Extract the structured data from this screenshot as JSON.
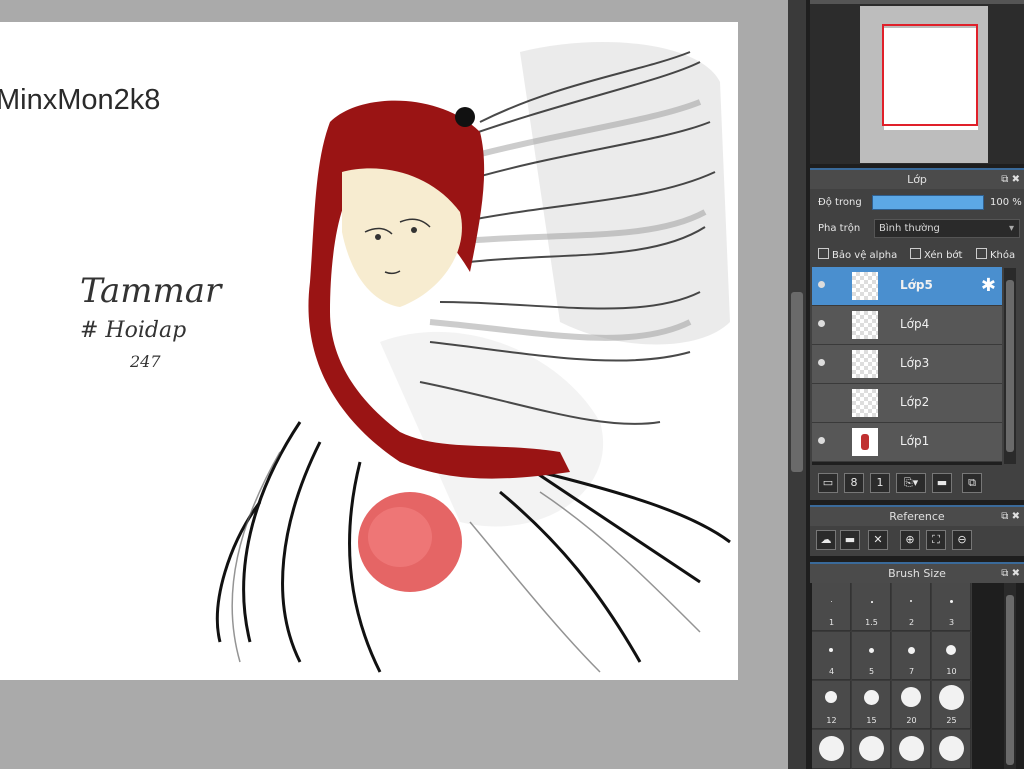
{
  "canvas": {
    "watermark": "MinxMon2k8",
    "signature_lines": [
      "Tammar",
      "# Hoidap",
      "247"
    ]
  },
  "layer_panel": {
    "title": "Lớp",
    "opacity_label": "Độ trong",
    "opacity_value": "100 %",
    "opacity_fraction": 1.0,
    "blend_label": "Pha trộn",
    "blend_value": "Bình thường",
    "checkboxes": {
      "protect_alpha": "Bảo vệ alpha",
      "clipping": "Xén bớt",
      "lock": "Khóa"
    },
    "layers": [
      {
        "name": "Lớp5",
        "selected": true,
        "visible": true
      },
      {
        "name": "Lớp4",
        "selected": false,
        "visible": true
      },
      {
        "name": "Lớp3",
        "selected": false,
        "visible": true
      },
      {
        "name": "Lớp2",
        "selected": false,
        "visible": false
      },
      {
        "name": "Lớp1",
        "selected": false,
        "visible": true
      }
    ]
  },
  "reference_panel": {
    "title": "Reference"
  },
  "brush_panel": {
    "title": "Brush Size",
    "sizes": [
      "1",
      "1.5",
      "2",
      "3",
      "4",
      "5",
      "7",
      "10",
      "12",
      "15",
      "20",
      "25"
    ]
  },
  "colors": {
    "accent": "#4a8fcf",
    "hair": "#9a1414",
    "panel": "#414141"
  }
}
